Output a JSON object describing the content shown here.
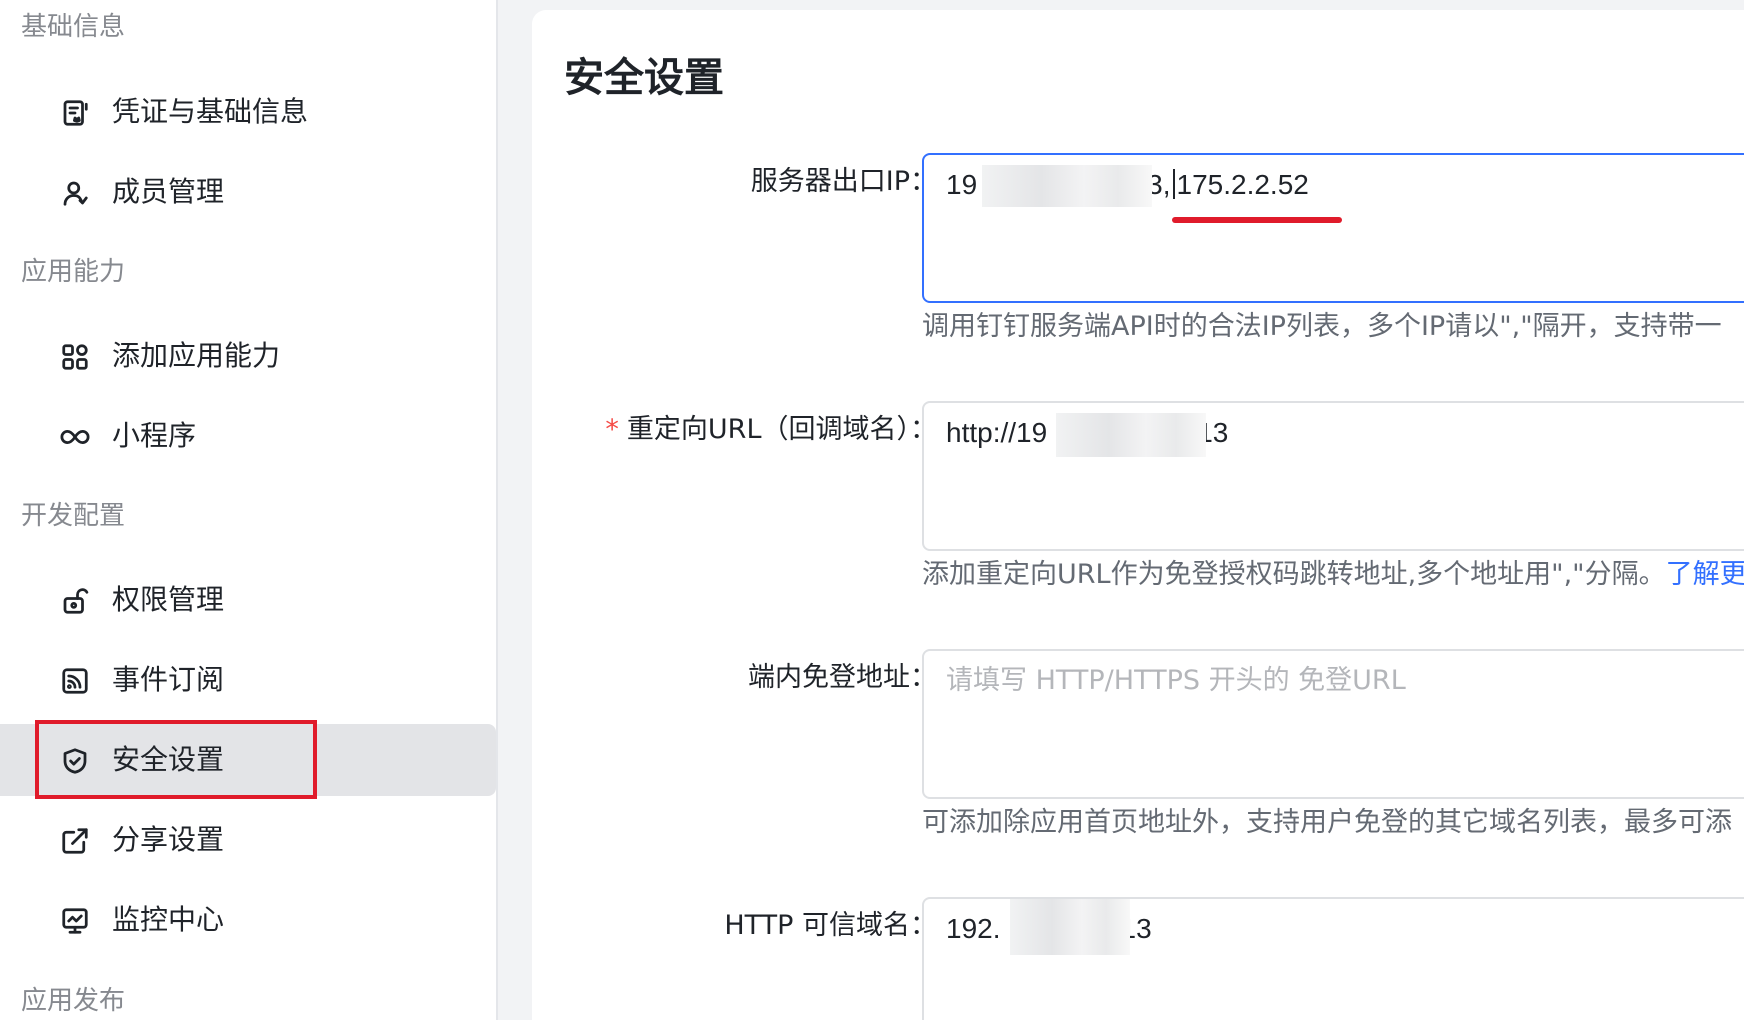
{
  "sidebar": {
    "groups": [
      {
        "title": "基础信息",
        "items": [
          {
            "label": "凭证与基础信息",
            "icon": "credential-icon"
          },
          {
            "label": "成员管理",
            "icon": "user-icon"
          }
        ]
      },
      {
        "title": "应用能力",
        "items": [
          {
            "label": "添加应用能力",
            "icon": "apps-grid-icon"
          },
          {
            "label": "小程序",
            "icon": "infinity-icon"
          }
        ]
      },
      {
        "title": "开发配置",
        "items": [
          {
            "label": "权限管理",
            "icon": "lock-icon"
          },
          {
            "label": "事件订阅",
            "icon": "rss-icon"
          },
          {
            "label": "安全设置",
            "icon": "shield-icon",
            "active": true
          },
          {
            "label": "分享设置",
            "icon": "share-icon"
          },
          {
            "label": "监控中心",
            "icon": "monitor-icon"
          }
        ]
      },
      {
        "title": "应用发布",
        "items": []
      }
    ]
  },
  "main": {
    "title": "安全设置",
    "fields": {
      "server_ip": {
        "label": "服务器出口IP：",
        "value_prefix": "19",
        "value_mid": "3,",
        "value_suffix": "175.2.2.52",
        "hint": "调用钉钉服务端API时的合法IP列表，多个IP请以\",\"隔开，支持带一"
      },
      "redirect_url": {
        "required_mark": "*",
        "label": "重定向URL（回调域名）：",
        "value_prefix": "http://19",
        "value_suffix": "13",
        "hint": "添加重定向URL作为免登授权码跳转地址,多个地址用\",\"分隔。",
        "hint_link": "了解更"
      },
      "in_app_login": {
        "label": "端内免登地址：",
        "placeholder": "请填写 HTTP/HTTPS 开头的 免登URL",
        "hint": "可添加除应用首页地址外，支持用户免登的其它域名列表，最多可添"
      },
      "http_trusted_domain": {
        "label": "HTTP 可信域名：",
        "value_prefix": "192.",
        "value_suffix": "13"
      }
    }
  },
  "colors": {
    "accent": "#3370ff",
    "annotation_red": "#e01b2b",
    "required": "#f54a45"
  }
}
